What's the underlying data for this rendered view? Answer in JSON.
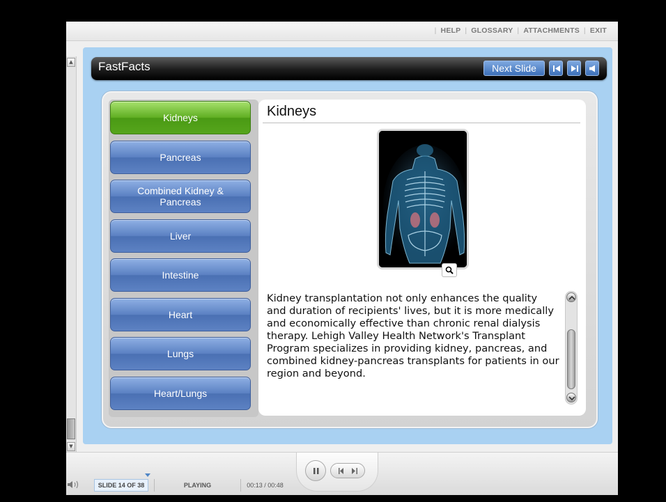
{
  "topnav": {
    "links": [
      "HELP",
      "GLOSSARY",
      "ATTACHMENTS",
      "EXIT"
    ]
  },
  "header": {
    "title": "FastFacts",
    "next_label": "Next Slide"
  },
  "tabs": [
    {
      "label": "Kidneys",
      "active": true
    },
    {
      "label": "Pancreas",
      "active": false
    },
    {
      "label": "Combined Kidney & Pancreas",
      "active": false
    },
    {
      "label": "Liver",
      "active": false
    },
    {
      "label": "Intestine",
      "active": false
    },
    {
      "label": "Heart",
      "active": false
    },
    {
      "label": "Lungs",
      "active": false
    },
    {
      "label": "Heart/Lungs",
      "active": false
    }
  ],
  "content": {
    "title": "Kidneys",
    "body": "Kidney transplantation not only enhances the quality and duration of recipients' lives, but it is more medically and economically effective than chronic renal dialysis therapy. Lehigh Valley Health Network's Transplant Program specializes in providing kidney, pancreas, and combined kidney-pancreas transplants for patients in our region and beyond."
  },
  "player": {
    "slide_counter": "SLIDE 14 OF 38",
    "status": "PLAYING",
    "time": "00:13 / 00:48"
  },
  "icons": {
    "zoom": "magnifier-icon",
    "prev": "rewind-icon",
    "next": "forward-icon",
    "audio": "speaker-icon",
    "pause": "pause-icon"
  },
  "colors": {
    "active_tab": "#5fae22",
    "tab": "#5a80c2",
    "slide_bg": "#a9d1f2",
    "header_bar": "#1c1c1c"
  }
}
